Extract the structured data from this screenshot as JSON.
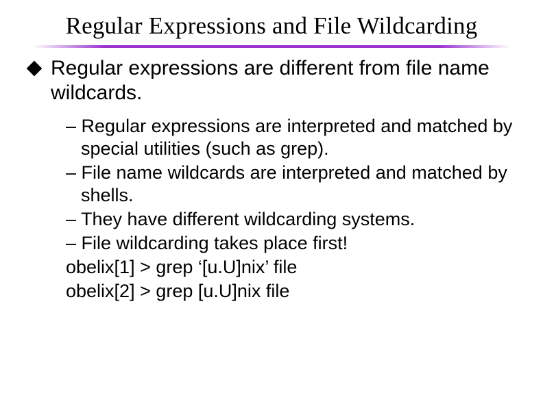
{
  "title": "Regular Expressions and File Wildcarding",
  "main_point": "Regular expressions are different from file name wildcards.",
  "subs": [
    "– Regular expressions are interpreted and matched by special utilities (such as grep).",
    "– File name wildcards are interpreted and matched by shells.",
    "– They have different wildcarding systems.",
    "– File wildcarding takes place first!"
  ],
  "code": [
    "obelix[1] > grep ‘[u.U]nix’ file",
    "obelix[2] > grep [u.U]nix file"
  ]
}
